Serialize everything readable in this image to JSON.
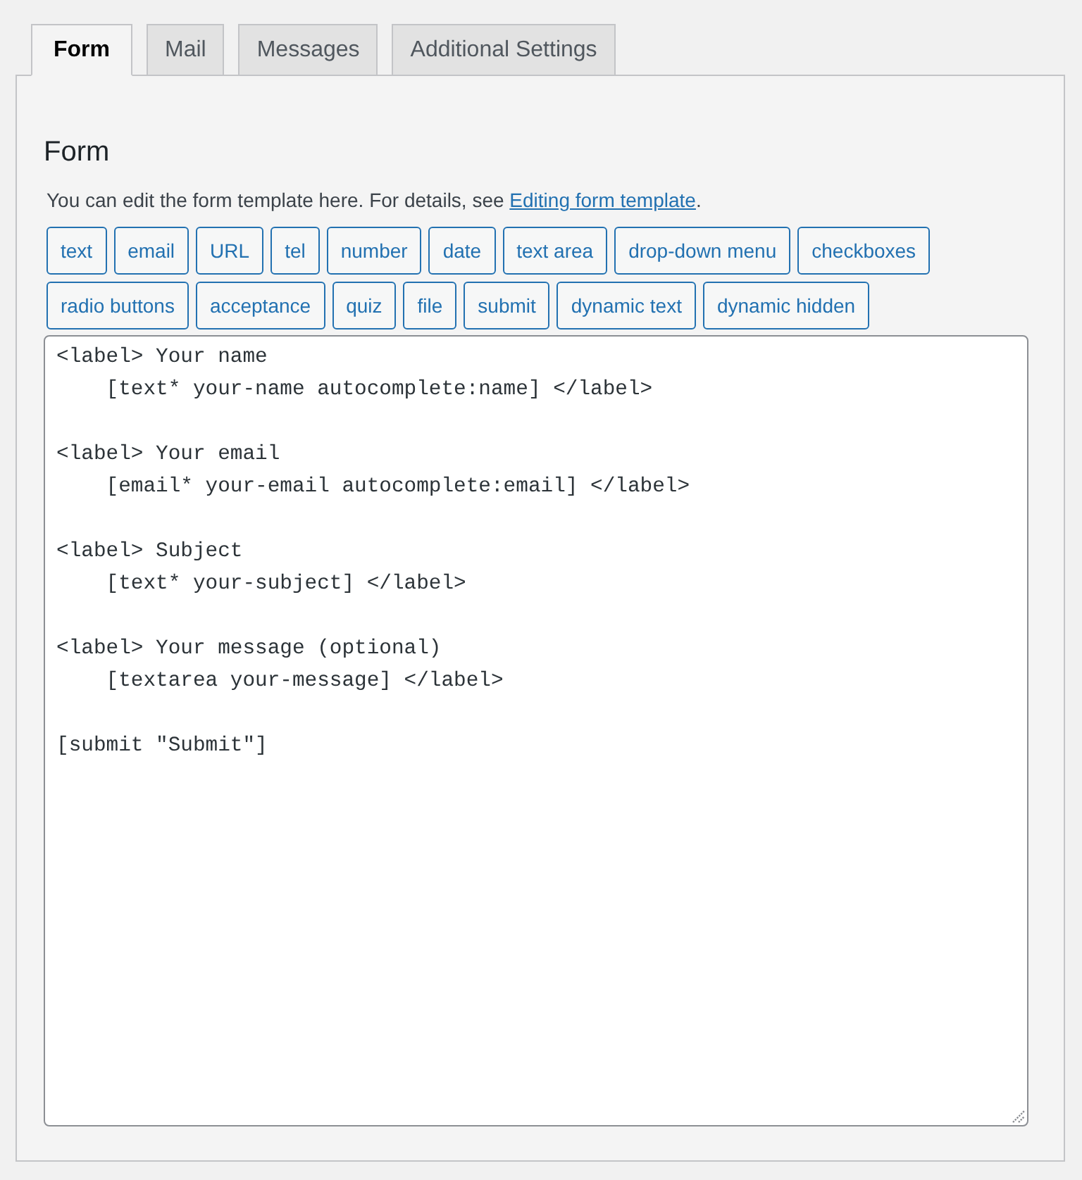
{
  "tabs": [
    {
      "label": "Form",
      "selected": true
    },
    {
      "label": "Mail",
      "selected": false
    },
    {
      "label": "Messages",
      "selected": false
    },
    {
      "label": "Additional Settings",
      "selected": false
    }
  ],
  "panel": {
    "heading": "Form",
    "description": {
      "text": "You can edit the form template here. For details, see ",
      "link": "Editing form template",
      "after": "."
    },
    "tag_button_rows": [
      [
        "text",
        "email",
        "URL",
        "tel",
        "number",
        "date",
        "text area",
        "drop-down menu",
        "checkboxes"
      ],
      [
        "radio buttons",
        "acceptance",
        "quiz",
        "file",
        "submit",
        "dynamic text",
        "dynamic hidden"
      ]
    ],
    "form_template": "<label> Your name\n    [text* your-name autocomplete:name] </label>\n\n<label> Your email\n    [email* your-email autocomplete:email] </label>\n\n<label> Subject\n    [text* your-subject] </label>\n\n<label> Your message (optional)\n    [textarea your-message] </label>\n\n[submit \"Submit\"]"
  }
}
